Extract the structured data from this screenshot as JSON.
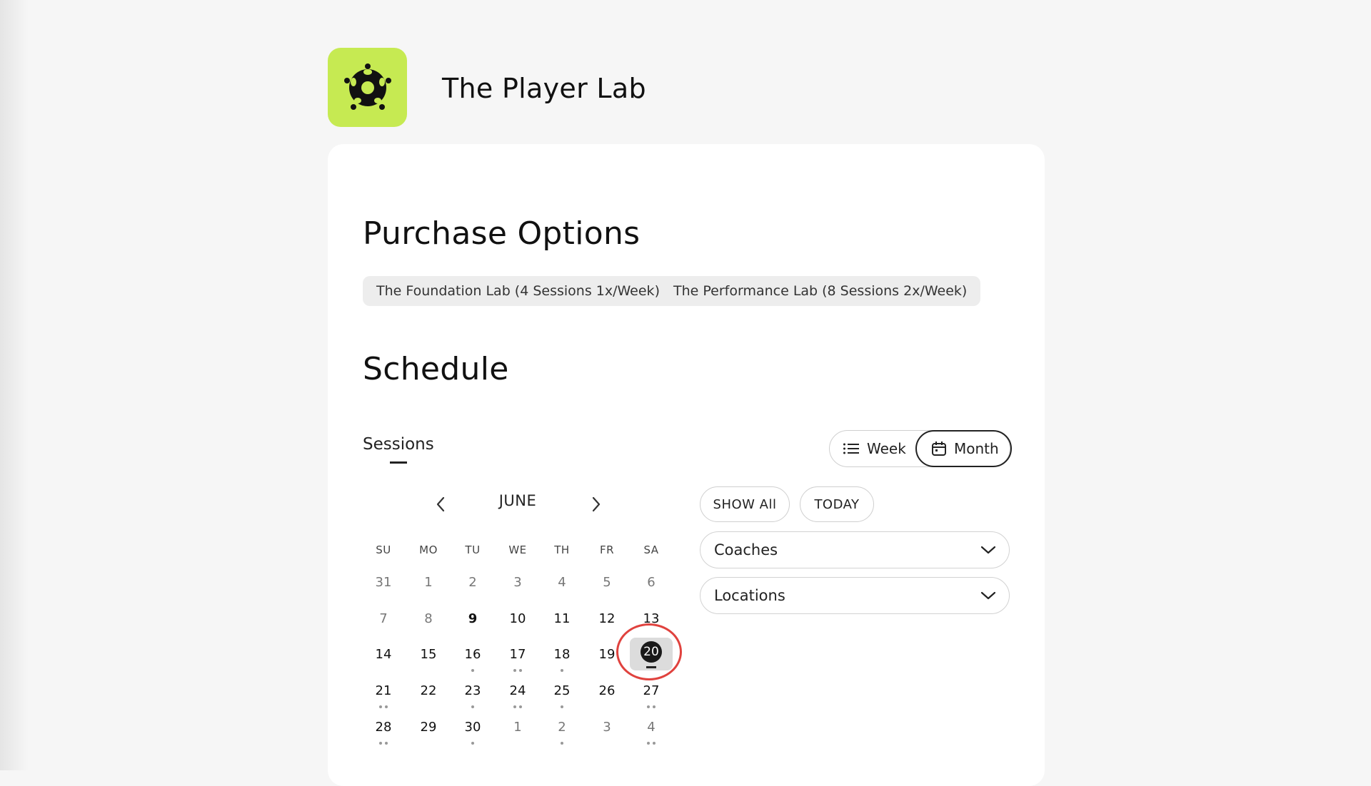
{
  "brand": {
    "name": "The Player Lab",
    "logo_icon": "soccer-ball-icon",
    "logo_color": "#c6ea52"
  },
  "purchase": {
    "title": "Purchase Options",
    "options": [
      {
        "label": "The Foundation Lab (4 Sessions 1x/Week)"
      },
      {
        "label": "The Performance Lab (8 Sessions 2x/Week)"
      }
    ]
  },
  "schedule": {
    "title": "Schedule",
    "sessions_tab": "Sessions",
    "view_toggle": {
      "week": "Week",
      "month": "Month",
      "active": "Month"
    },
    "calendar": {
      "month": "JUNE",
      "weekdays": [
        "SU",
        "MO",
        "TU",
        "WE",
        "TH",
        "FR",
        "SA"
      ],
      "weeks": [
        [
          {
            "d": "31",
            "muted": true,
            "dots": 0
          },
          {
            "d": "1",
            "muted": true,
            "dots": 0
          },
          {
            "d": "2",
            "muted": true,
            "dots": 0
          },
          {
            "d": "3",
            "muted": true,
            "dots": 0
          },
          {
            "d": "4",
            "muted": true,
            "dots": 0
          },
          {
            "d": "5",
            "muted": true,
            "dots": 0
          },
          {
            "d": "6",
            "muted": true,
            "dots": 0
          }
        ],
        [
          {
            "d": "7",
            "muted": true,
            "dots": 0
          },
          {
            "d": "8",
            "muted": true,
            "dots": 0
          },
          {
            "d": "9",
            "bold": true,
            "dots": 0
          },
          {
            "d": "10",
            "dots": 0
          },
          {
            "d": "11",
            "dots": 0
          },
          {
            "d": "12",
            "dots": 0
          },
          {
            "d": "13",
            "dots": 0
          }
        ],
        [
          {
            "d": "14",
            "dots": 0
          },
          {
            "d": "15",
            "dots": 0
          },
          {
            "d": "16",
            "dots": 1
          },
          {
            "d": "17",
            "dots": 2
          },
          {
            "d": "18",
            "dots": 1
          },
          {
            "d": "19",
            "dots": 0
          },
          {
            "d": "20",
            "selected": true,
            "dots": 0
          }
        ],
        [
          {
            "d": "21",
            "dots": 2
          },
          {
            "d": "22",
            "dots": 0
          },
          {
            "d": "23",
            "dots": 1
          },
          {
            "d": "24",
            "dots": 2
          },
          {
            "d": "25",
            "dots": 1
          },
          {
            "d": "26",
            "dots": 0
          },
          {
            "d": "27",
            "dots": 2
          }
        ],
        [
          {
            "d": "28",
            "dots": 2
          },
          {
            "d": "29",
            "dots": 0
          },
          {
            "d": "30",
            "dots": 1
          },
          {
            "d": "1",
            "muted": true,
            "dots": 0
          },
          {
            "d": "2",
            "muted": true,
            "dots": 1
          },
          {
            "d": "3",
            "muted": true,
            "dots": 0
          },
          {
            "d": "4",
            "muted": true,
            "dots": 2
          }
        ]
      ]
    },
    "filters": {
      "show_all": "SHOW All",
      "today": "TODAY",
      "coaches": "Coaches",
      "locations": "Locations"
    }
  },
  "colors": {
    "accent": "#c6ea52",
    "annotation_ring": "#e0423e",
    "selected_day": "#1a1a1a"
  }
}
